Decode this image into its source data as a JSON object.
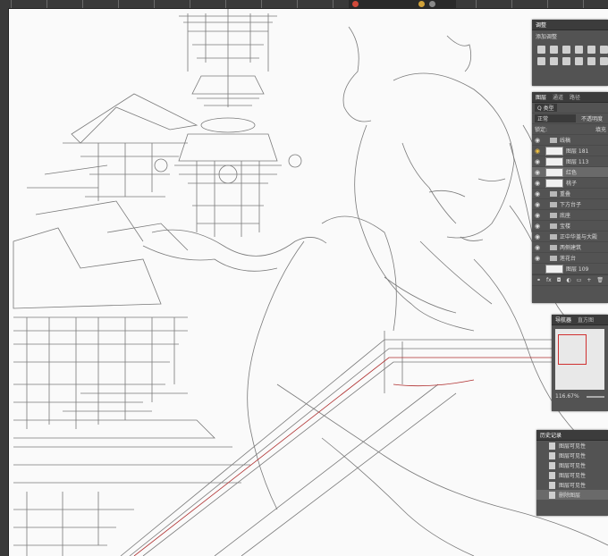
{
  "app": {
    "title_bar_dots": [
      "#d04a3a",
      "#d0a23a",
      "#8a8a8a"
    ]
  },
  "adjustments": {
    "title": "调整",
    "subtitle": "添加调整"
  },
  "layers": {
    "tabs": [
      "图层",
      "通道",
      "路径"
    ],
    "filter_label": "Q 类型",
    "blend_mode": "正常",
    "opacity_label": "不透明度",
    "lock_label": "锁定:",
    "fill_label": "填充",
    "items": [
      {
        "label": "线稿",
        "kind": "folder",
        "visible": true
      },
      {
        "label": "图层 181",
        "kind": "layer",
        "visible": true,
        "highlight": true
      },
      {
        "label": "图层 113",
        "kind": "layer",
        "visible": true
      },
      {
        "label": "红色",
        "kind": "layer",
        "visible": true,
        "selected": true
      },
      {
        "label": "桃子",
        "kind": "layer",
        "visible": true
      },
      {
        "label": "重叠",
        "kind": "folder",
        "visible": true
      },
      {
        "label": "下方台子",
        "kind": "folder",
        "visible": true
      },
      {
        "label": "底座",
        "kind": "folder",
        "visible": true
      },
      {
        "label": "宝楼",
        "kind": "folder",
        "visible": true
      },
      {
        "label": "正中华盖与大殿",
        "kind": "folder",
        "visible": true
      },
      {
        "label": "两侧建筑",
        "kind": "folder",
        "visible": true
      },
      {
        "label": "莲花台",
        "kind": "folder",
        "visible": true
      },
      {
        "label": "图层 109",
        "kind": "layer",
        "visible": false
      }
    ]
  },
  "navigator": {
    "tabs": [
      "导航器",
      "直方图"
    ],
    "zoom": "116.67%"
  },
  "history": {
    "tabs": [
      "历史记录"
    ],
    "items": [
      "图层可见性",
      "图层可见性",
      "图层可见性",
      "图层可见性",
      "图层可见性",
      "删除图层"
    ]
  }
}
